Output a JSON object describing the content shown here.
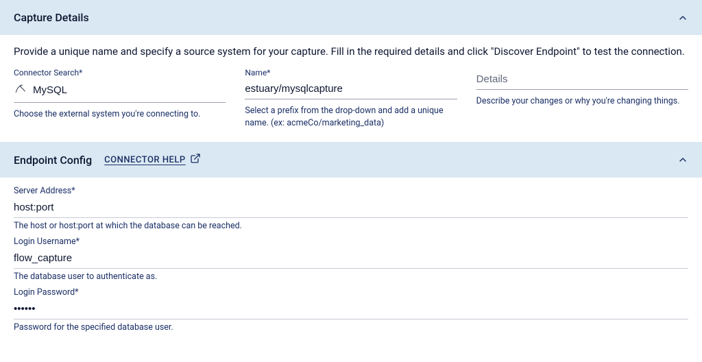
{
  "capture_details": {
    "title": "Capture Details",
    "instruction": "Provide a unique name and specify a source system for your capture. Fill in the required details and click \"Discover Endpoint\" to test the connection.",
    "connector_search": {
      "label": "Connector Search*",
      "value": "MySQL",
      "help": "Choose the external system you're connecting to.",
      "icon": "mysql-icon"
    },
    "name": {
      "label": "Name*",
      "value": "estuary/mysqlcapture",
      "help": "Select a prefix from the drop-down and add a unique name. (ex: acmeCo/marketing_data)"
    },
    "details": {
      "label": "",
      "placeholder": "Details",
      "value": "",
      "help": "Describe your changes or why you're changing things."
    }
  },
  "endpoint_config": {
    "title": "Endpoint Config",
    "connector_help_label": "CONNECTOR HELP",
    "server_address": {
      "label": "Server Address*",
      "value": "host:port",
      "help": "The host or host:port at which the database can be reached."
    },
    "login_username": {
      "label": "Login Username*",
      "value": "flow_capture",
      "help": "The database user to authenticate as."
    },
    "login_password": {
      "label": "Login Password*",
      "value": "••••••",
      "help": "Password for the specified database user."
    }
  }
}
